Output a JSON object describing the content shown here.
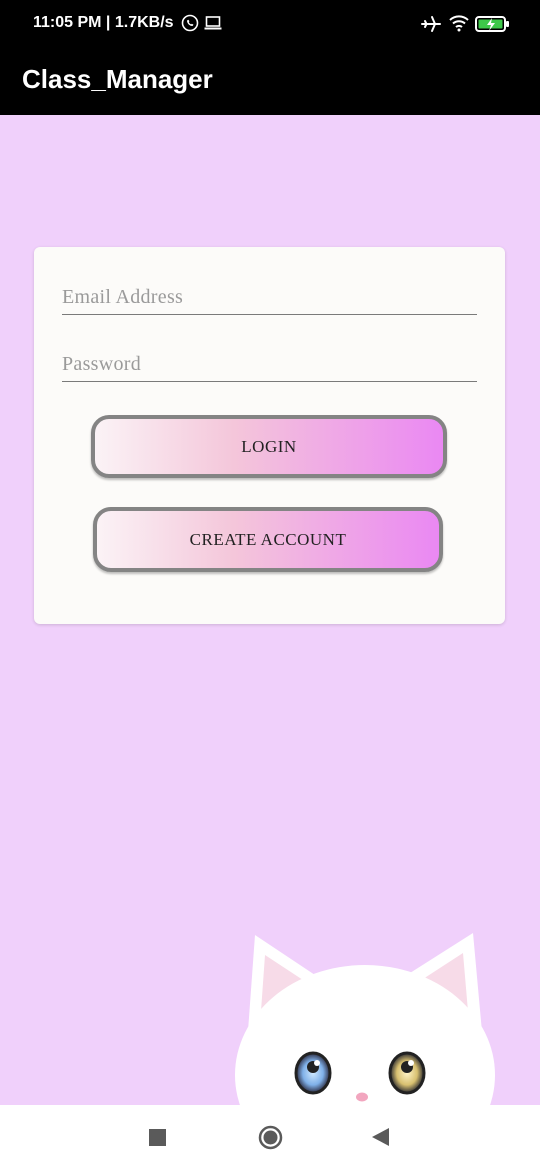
{
  "status_bar": {
    "time": "11:05 PM | 1.7KB/s",
    "icons": [
      "whatsapp-icon",
      "laptop-icon",
      "airplane-icon",
      "wifi-icon",
      "battery-charging-icon"
    ]
  },
  "app_bar": {
    "title": "Class_Manager"
  },
  "login_form": {
    "email": {
      "placeholder": "Email Address",
      "value": ""
    },
    "password": {
      "placeholder": "Password",
      "value": ""
    },
    "login_label": "LOGIN",
    "create_account_label": "CREATE ACCOUNT"
  },
  "colors": {
    "background": "#f0d0fb",
    "app_bar": "#000000",
    "card": "#fcfbf9",
    "button_gradient_start": "#fbf3f6",
    "button_gradient_end": "#ea88f3",
    "button_border": "#848484"
  },
  "nav_bar": {
    "icons": [
      "recents-square-icon",
      "home-circle-icon",
      "back-triangle-icon"
    ]
  }
}
